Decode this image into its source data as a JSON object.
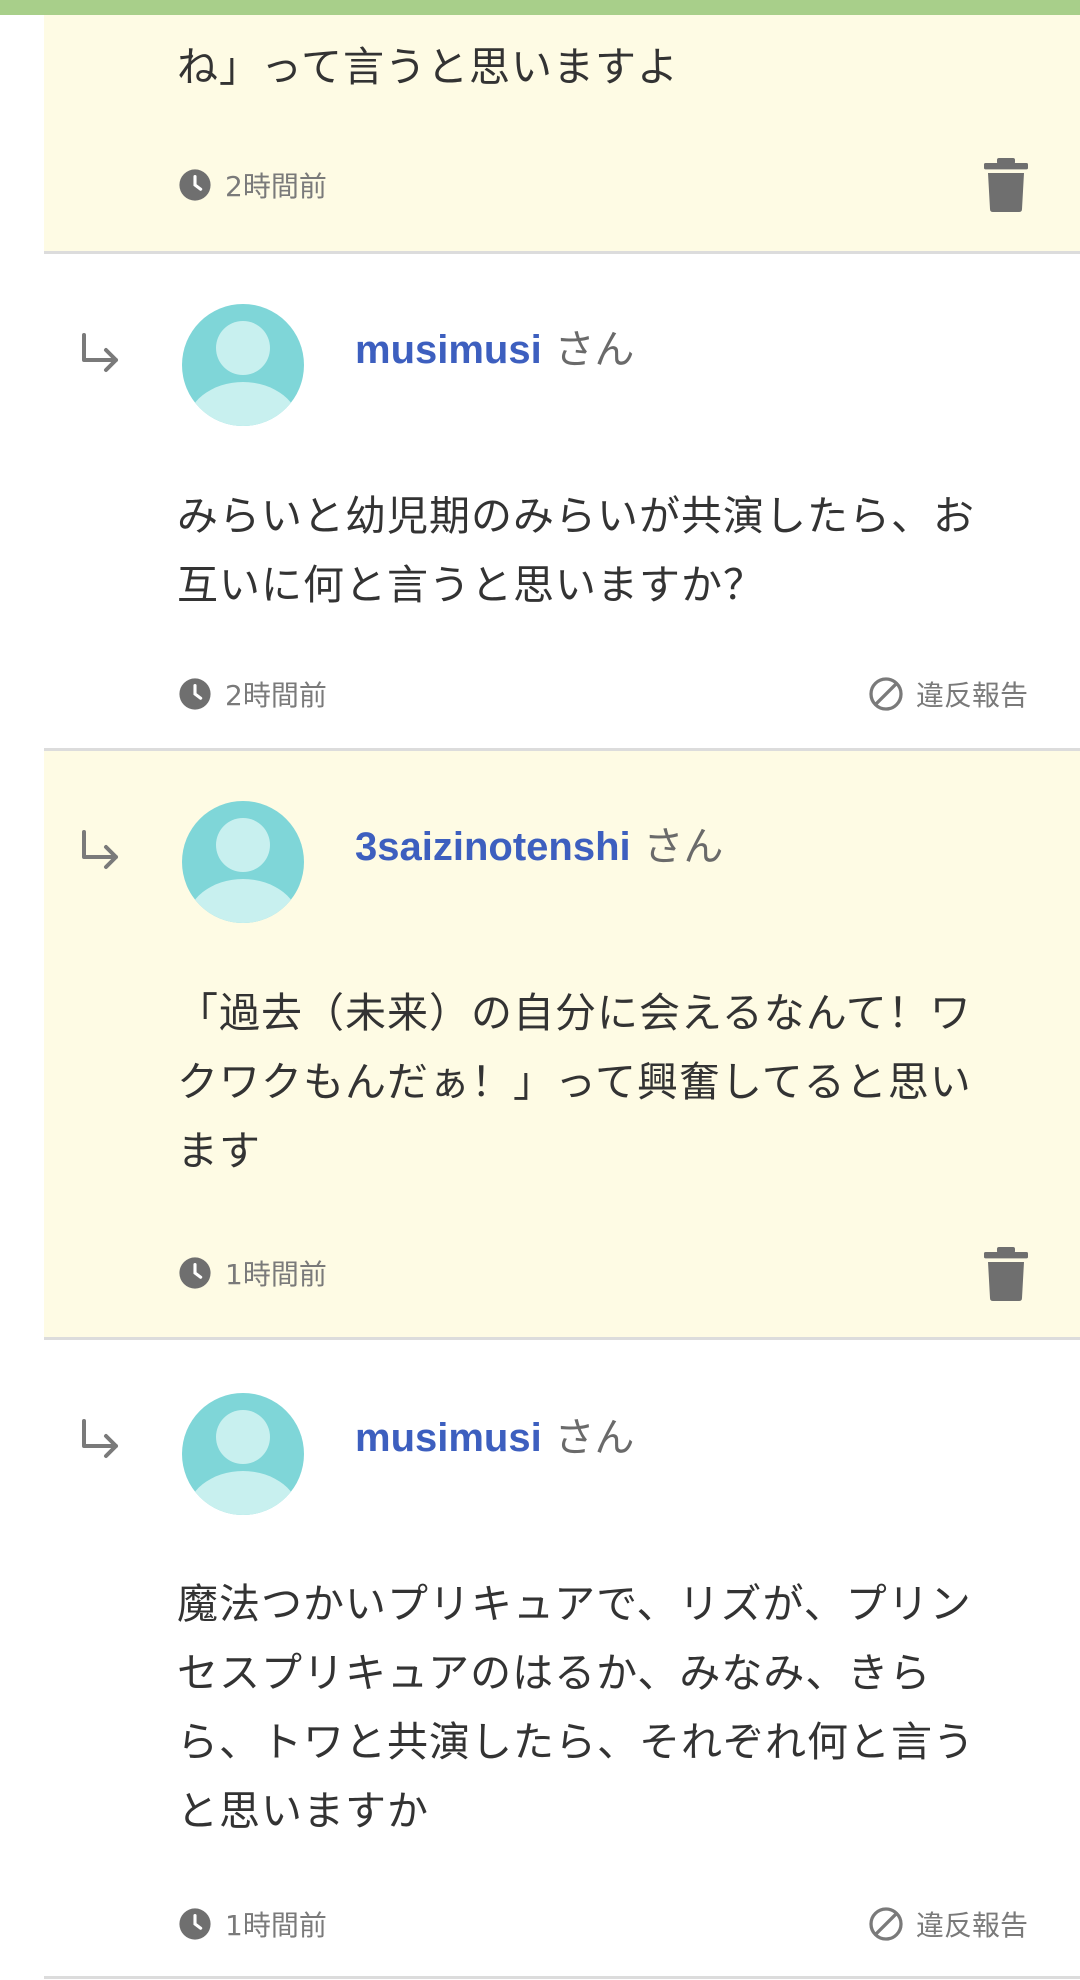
{
  "comments": [
    {
      "own": true,
      "text_lines": [
        "ね」って言うと思いますよ"
      ],
      "time": "2時間前"
    },
    {
      "own": false,
      "username": "musimusi",
      "suffix": "さん",
      "text_lines": [
        "みらいと幼児期のみらいが共演したら、お",
        "互いに何と言うと思いますか？"
      ],
      "time": "2時間前",
      "report_label": "違反報告"
    },
    {
      "own": true,
      "username": "3saizinotenshi",
      "suffix": "さん",
      "text_lines": [
        "「過去（未来）の自分に会えるなんて！ワ",
        "クワクもんだぁ！」って興奮してると思い",
        "ます"
      ],
      "time": "1時間前"
    },
    {
      "own": false,
      "username": "musimusi",
      "suffix": "さん",
      "text_lines": [
        "魔法つかいプリキュアで、リズが、プリン",
        "セスプリキュアのはるか、みなみ、きら",
        "ら、トワと共演したら、それぞれ何と言う",
        "と思いますか"
      ],
      "time": "1時間前",
      "report_label": "違反報告"
    }
  ],
  "colors": {
    "top_bar": "#a8cf8a",
    "own_comment_bg": "#fefbe4",
    "username": "#3d5fbf",
    "avatar": "#7fd6d8",
    "avatar_figure": "#c8f0ef"
  },
  "icons": {
    "reply": "reply-arrow-icon",
    "time": "clock-icon",
    "delete": "trash-icon",
    "report": "prohibited-icon"
  }
}
